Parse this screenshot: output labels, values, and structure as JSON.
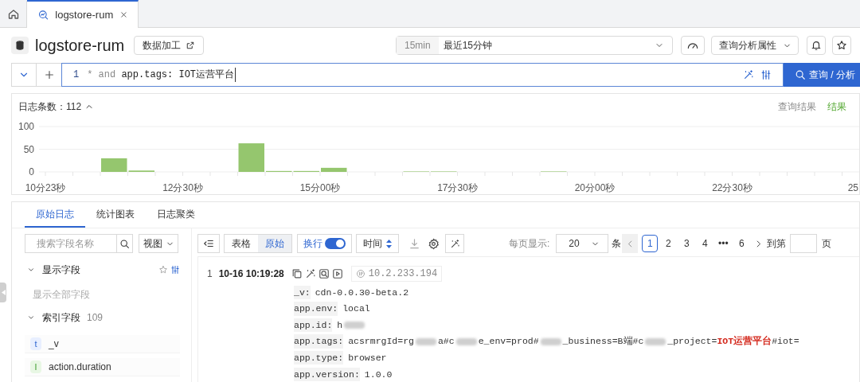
{
  "tabs": [
    {
      "kind": "home",
      "selected": false
    },
    {
      "kind": "page",
      "label": "logstore-rum",
      "selected": true
    }
  ],
  "header": {
    "title": "logstore-rum",
    "process_button": "数据加工",
    "time_range": {
      "badge": "15min",
      "value": "最近15分钟"
    },
    "properties_button": "查询分析属性"
  },
  "query": {
    "line_number": "1",
    "tokens": [
      {
        "kind": "operator",
        "text": "*"
      },
      {
        "kind": "keyword",
        "text": "and"
      },
      {
        "kind": "field",
        "text": "app.tags:"
      },
      {
        "kind": "value",
        "text": "IOT运营平台"
      }
    ],
    "submit": "查询 / 分析"
  },
  "histogram": {
    "count_label": "日志条数：",
    "count": "112",
    "expanded": true,
    "links": [
      {
        "label": "查询结果",
        "selected": false
      },
      {
        "label": "结果",
        "selected": true
      }
    ],
    "chart_data": {
      "type": "bar",
      "categories": [
        "10分23秒",
        null,
        null,
        null,
        null,
        "12分30秒",
        null,
        null,
        null,
        null,
        "15分00秒",
        null,
        null,
        null,
        null,
        "17分30秒",
        null,
        null,
        null,
        null,
        "20分00秒",
        null,
        null,
        null,
        null,
        "22分30秒",
        null,
        null,
        null,
        "25"
      ],
      "ylim": [
        0,
        100
      ],
      "yticks": [
        0,
        50,
        100
      ],
      "series": [
        {
          "color": "#95c66e",
          "values": [
            0,
            0,
            30,
            3,
            0,
            0,
            0,
            63,
            2,
            2,
            9,
            0,
            0,
            1,
            1,
            0,
            0,
            0,
            1,
            0,
            0,
            0,
            0,
            0,
            0,
            0,
            0,
            0,
            0,
            0
          ]
        }
      ]
    }
  },
  "result_tabs": [
    {
      "label": "原始日志",
      "selected": true
    },
    {
      "label": "统计图表",
      "selected": false
    },
    {
      "label": "日志聚类",
      "selected": false
    }
  ],
  "sidebar": {
    "search_placeholder": "搜索字段名称",
    "view_select": "视图",
    "sections": [
      {
        "title": "显示字段",
        "expanded": true,
        "empty_text": "显示全部字段"
      },
      {
        "title": "索引字段",
        "count": "109",
        "expanded": true,
        "fields": [
          {
            "type": "t",
            "name": "_v"
          },
          {
            "type": "l",
            "name": "action.duration"
          }
        ]
      }
    ]
  },
  "toolbar": {
    "view_modes": [
      {
        "label": "表格",
        "selected": false
      },
      {
        "label": "原始",
        "selected": true
      }
    ],
    "wrap": {
      "label": "换行",
      "on": true
    },
    "sort": "时间",
    "page_size_label": "每页显示:",
    "page_size": "20",
    "page_size_unit": "条",
    "pages": [
      {
        "label": "1",
        "selected": true
      },
      {
        "label": "2",
        "selected": false
      },
      {
        "label": "3",
        "selected": false
      },
      {
        "label": "4",
        "selected": false
      },
      {
        "label": "•••",
        "selected": false
      },
      {
        "label": "6",
        "selected": false
      }
    ],
    "goto_label": "到第",
    "goto_unit": "页"
  },
  "logs": [
    {
      "index": "1",
      "time": "10-16 10:19:28",
      "source": "10.2.233.194",
      "fields": [
        {
          "key": "_v:",
          "value": [
            {
              "kind": "text",
              "text": "cdn-0.0.30-beta.2"
            }
          ]
        },
        {
          "key": "app.env:",
          "value": [
            {
              "kind": "text",
              "text": "local"
            }
          ]
        },
        {
          "key": "app.id:",
          "value": [
            {
              "kind": "text",
              "text": "h"
            },
            {
              "kind": "redacted"
            }
          ]
        },
        {
          "key": "app.tags:",
          "value": [
            {
              "kind": "text",
              "text": "acsrmrgId=rg"
            },
            {
              "kind": "redacted"
            },
            {
              "kind": "text",
              "text": "a#c"
            },
            {
              "kind": "redacted"
            },
            {
              "kind": "text",
              "text": "e_env=prod#"
            },
            {
              "kind": "redacted"
            },
            {
              "kind": "text",
              "text": "_business=B端#c"
            },
            {
              "kind": "redacted"
            },
            {
              "kind": "text",
              "text": "_project="
            },
            {
              "kind": "highlight",
              "text": "IOT运营平台"
            },
            {
              "kind": "text",
              "text": "#iot="
            }
          ]
        },
        {
          "key": "app.type:",
          "value": [
            {
              "kind": "text",
              "text": "browser"
            }
          ]
        },
        {
          "key": "app.version:",
          "value": [
            {
              "kind": "text",
              "text": "1.0.0"
            }
          ]
        }
      ]
    }
  ]
}
